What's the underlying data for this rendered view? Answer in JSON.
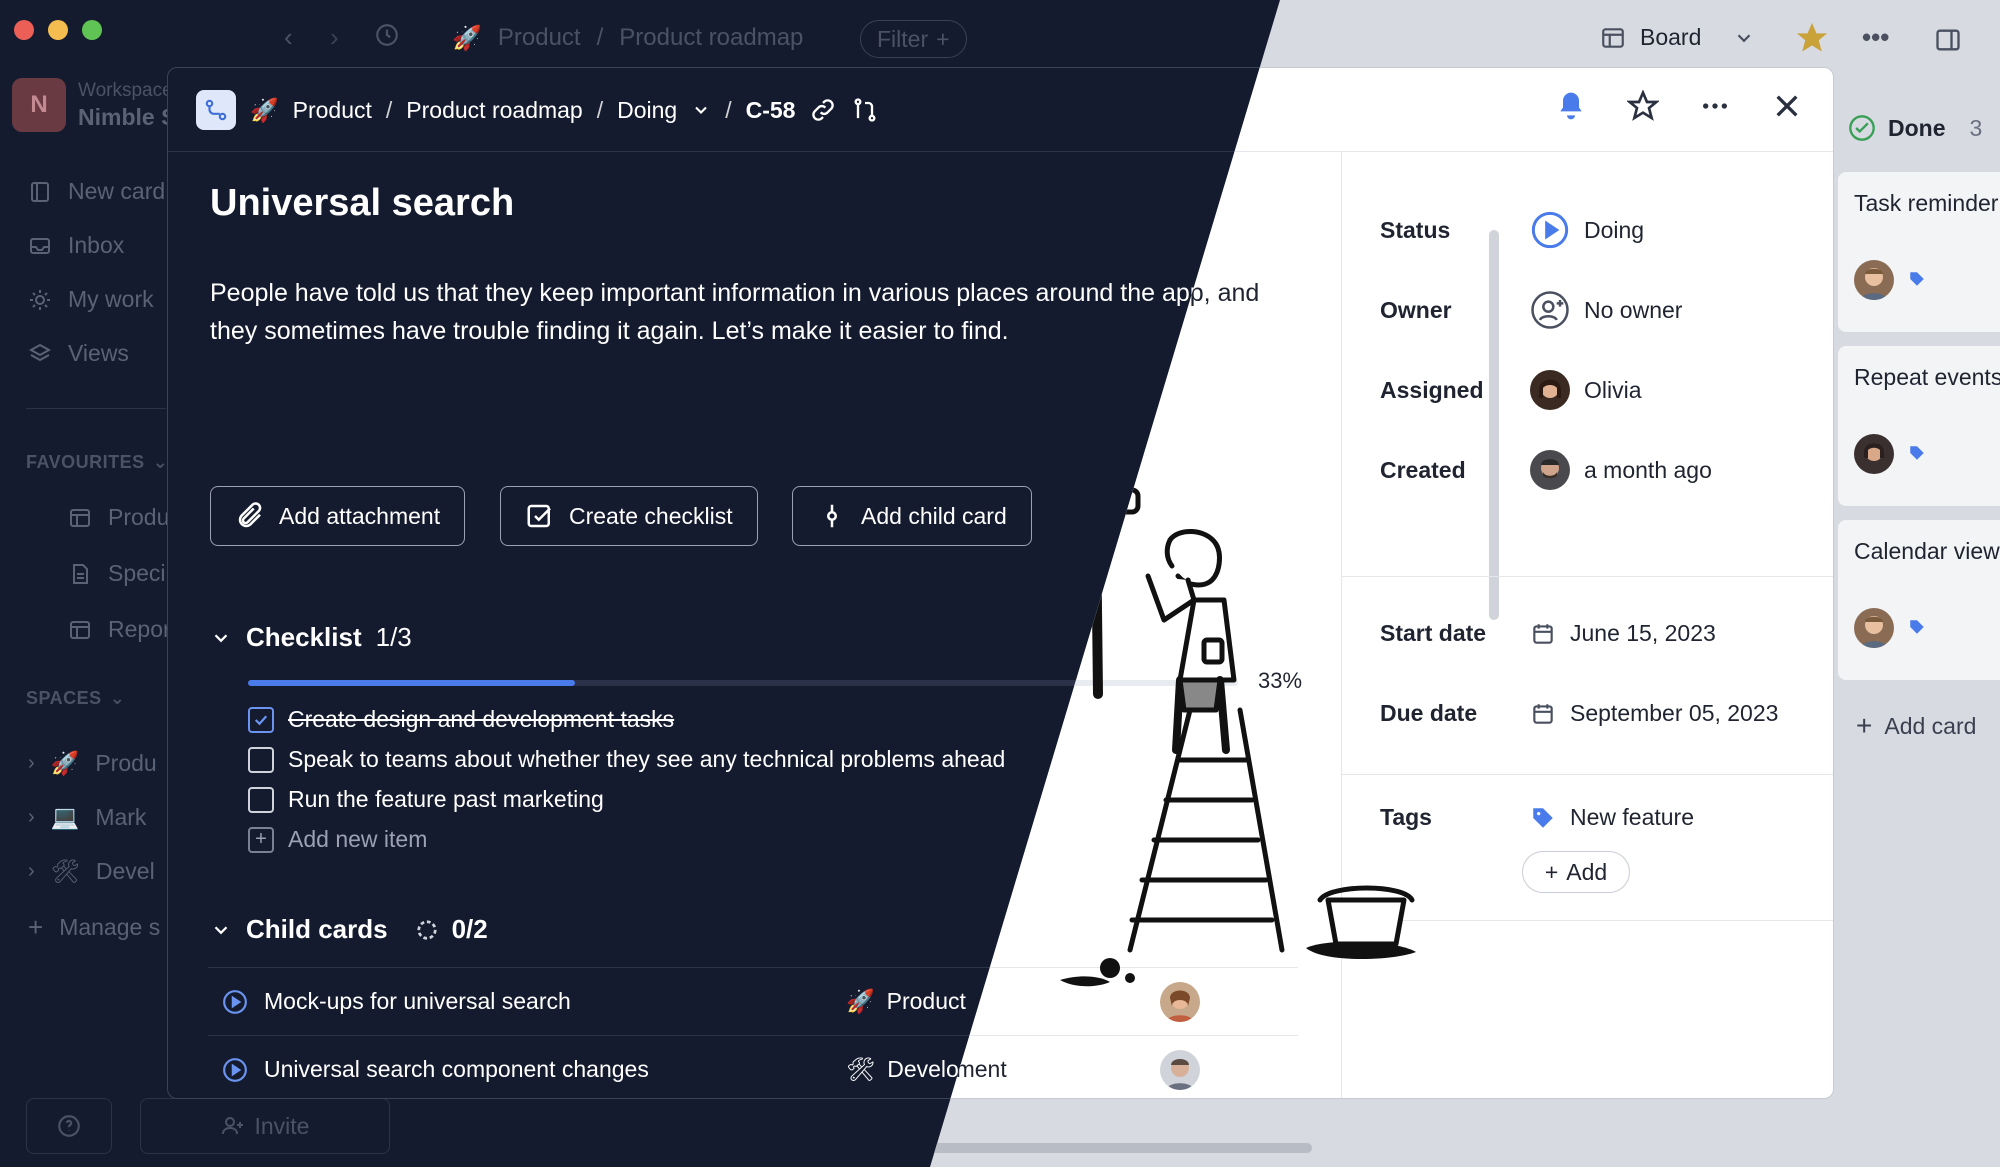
{
  "app": {
    "workspace_label": "Workspace",
    "workspace_name": "Nimble S",
    "avatar_letter": "N"
  },
  "toolbar": {
    "breadcrumb_space": "Product",
    "breadcrumb_board": "Product roadmap",
    "filter_label": "Filter",
    "view_label": "Board"
  },
  "sidebar": {
    "items": [
      {
        "label": "New card",
        "icon": "new-card-icon"
      },
      {
        "label": "Inbox",
        "icon": "inbox-icon"
      },
      {
        "label": "My work",
        "icon": "sun-icon"
      },
      {
        "label": "Views",
        "icon": "layers-icon"
      }
    ],
    "favourites_label": "FAVOURITES",
    "favourites": [
      "Produ",
      "Speci",
      "Repor"
    ],
    "spaces_label": "SPACES",
    "spaces": [
      "Produ",
      "Mark",
      "Devel"
    ],
    "manage_label": "Manage s",
    "invite_label": "Invite"
  },
  "modal": {
    "breadcrumb": {
      "space": "Product",
      "board": "Product roadmap",
      "column": "Doing",
      "card_id": "C-58"
    },
    "title": "Universal search",
    "description": "People have told us that they keep important information in various places around the app, and they sometimes have trouble finding it again. Let’s make it easier to find.",
    "actions": {
      "add_attachment": "Add attachment",
      "create_checklist": "Create checklist",
      "add_child_card": "Add child card"
    },
    "checklist": {
      "title": "Checklist",
      "count": "1/3",
      "progress_fraction": 0.33,
      "percent_label": "33%",
      "items": [
        {
          "text": "Create design and development tasks",
          "done": true
        },
        {
          "text": "Speak to teams about whether they see any technical problems ahead",
          "done": false
        },
        {
          "text": "Run the feature past marketing",
          "done": false
        }
      ],
      "add_item_label": "Add new item"
    },
    "child_cards": {
      "title": "Child cards",
      "count": "0/2",
      "rows": [
        {
          "name": "Mock-ups for universal search",
          "project": "Product"
        },
        {
          "name": "Universal search component changes",
          "project": "Development"
        }
      ]
    },
    "properties": {
      "status_label": "Status",
      "status_value": "Doing",
      "owner_label": "Owner",
      "owner_value": "No owner",
      "assigned_label": "Assigned",
      "assigned_value": "Olivia",
      "created_label": "Created",
      "created_value": "a month ago",
      "start_label": "Start date",
      "start_value": "June 15, 2023",
      "due_label": "Due date",
      "due_value": "September 05, 2023",
      "tags_label": "Tags",
      "tag_value": "New feature",
      "add_tag_label": "Add"
    }
  },
  "board": {
    "done_label": "Done",
    "done_count": "3",
    "cards": [
      "Task reminder",
      "Repeat events",
      "Calendar view"
    ],
    "add_card_label": "Add card"
  },
  "colors": {
    "dark_bg": "#151b2e",
    "accent_blue": "#4a7bea",
    "light_bg": "#ffffff"
  }
}
